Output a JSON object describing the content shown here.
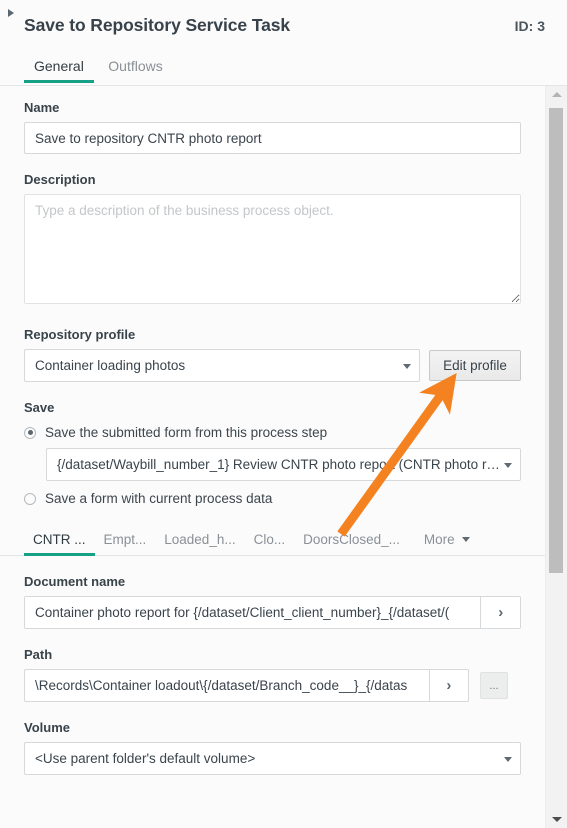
{
  "header": {
    "collapse_icon": "triangle-right-icon",
    "title": "Save to Repository Service Task",
    "id_label": "ID: 3"
  },
  "top_tabs": [
    {
      "label": "General",
      "active": true
    },
    {
      "label": "Outflows",
      "active": false
    }
  ],
  "form": {
    "name": {
      "label": "Name",
      "value": "Save to repository CNTR photo report"
    },
    "description": {
      "label": "Description",
      "value": "",
      "placeholder": "Type a description of the business process object."
    },
    "repository_profile": {
      "label": "Repository profile",
      "value": "Container loading photos",
      "edit_button": "Edit profile"
    },
    "save": {
      "label": "Save",
      "option_submitted": "Save the submitted form from this process step",
      "option_submitted_selected": true,
      "form_select_value": "{/dataset/Waybill_number_1} Review CNTR photo report (CNTR photo r…",
      "option_current": "Save a form with current process data",
      "option_current_selected": false
    },
    "document_name": {
      "label": "Document name",
      "value": "Container photo report for {/dataset/Client_client_number}_{/dataset/(",
      "expand_icon": "chevron-right-icon"
    },
    "path": {
      "label": "Path",
      "value": "\\Records\\Container loadout\\{/dataset/Branch_code__}_{/datas",
      "expand_icon": "chevron-right-icon",
      "browse_label": "..."
    },
    "volume": {
      "label": "Volume",
      "value": "<Use parent folder's default volume>"
    }
  },
  "inner_tabs": [
    {
      "label": "CNTR ...",
      "active": true
    },
    {
      "label": "Empt...",
      "active": false
    },
    {
      "label": "Loaded_h...",
      "active": false
    },
    {
      "label": "Clo...",
      "active": false
    },
    {
      "label": "DoorsClosed_...",
      "active": false
    }
  ],
  "inner_tabs_more": "More",
  "scrollbar": {
    "up_icon": "triangle-up-icon",
    "down_icon": "triangle-down-icon"
  },
  "annotation": {
    "type": "arrow",
    "color": "#F58220",
    "points_to": "Edit profile"
  },
  "colors": {
    "accent": "#16a085",
    "annotation": "#F58220",
    "panel_bg": "#fbfbfb",
    "input_bg": "#ffffff"
  }
}
